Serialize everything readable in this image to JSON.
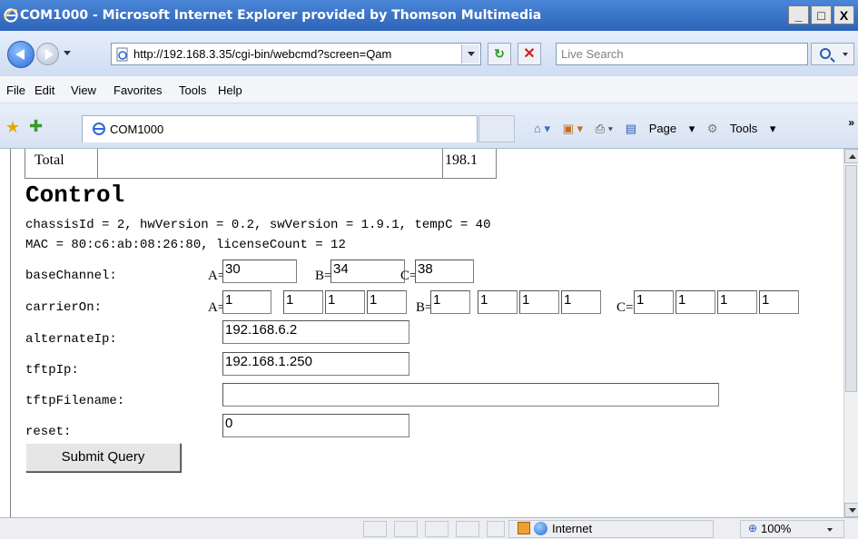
{
  "window": {
    "title": "COM1000 - Microsoft Internet Explorer provided by Thomson Multimedia",
    "minimize": "_",
    "maximize": "□",
    "close": "X"
  },
  "address": {
    "url": "http://192.168.3.35/cgi-bin/webcmd?screen=Qam",
    "search_placeholder": "Live Search"
  },
  "menu": [
    "File",
    "Edit",
    "View",
    "Favorites",
    "Tools",
    "Help"
  ],
  "tab": {
    "label": "COM1000"
  },
  "commands": {
    "page": "Page",
    "tools": "Tools",
    "more": "»"
  },
  "page": {
    "total_label": "Total",
    "total_value": "198.1",
    "heading": "Control",
    "info_line1": "chassisId = 2, hwVersion = 0.2, swVersion = 1.9.1, tempC = 40",
    "info_line2": "MAC = 80:c6:ab:08:26:80, licenseCount = 12",
    "fields": {
      "baseChannel": {
        "label": "baseChannel:",
        "prefixes": [
          "A=",
          "B=",
          "C="
        ],
        "values": [
          "30",
          "34",
          "38"
        ]
      },
      "carrierOn": {
        "label": "carrierOn:",
        "prefixes": [
          "A=",
          "B=",
          "C="
        ],
        "values": [
          "1",
          "1",
          "1",
          "1",
          "1",
          "1",
          "1",
          "1",
          "1",
          "1",
          "1",
          "1"
        ]
      },
      "alternateIp": {
        "label": "alternateIp:",
        "value": "192.168.6.2"
      },
      "tftpIp": {
        "label": "tftpIp:",
        "value": "192.168.1.250"
      },
      "tftpFilename": {
        "label": "tftpFilename:",
        "value": ""
      },
      "reset": {
        "label": "reset:",
        "value": "0"
      }
    },
    "submit_label": "Submit Query"
  },
  "status": {
    "zone": "Internet",
    "zoom": "100%"
  },
  "icons": {
    "ie_logo": "ie-logo-icon",
    "back": "back-arrow-icon",
    "forward": "forward-arrow-icon",
    "refresh": "refresh-icon",
    "stop": "stop-icon",
    "search": "search-icon",
    "favorites": "favorites-star-icon",
    "add_favorites": "add-favorites-icon",
    "home": "home-icon",
    "feeds": "feeds-icon",
    "print": "print-icon",
    "page": "page-icon",
    "tools": "gear-icon",
    "globe": "globe-icon",
    "protected_mode": "protected-mode-icon",
    "zoom": "zoom-icon"
  }
}
